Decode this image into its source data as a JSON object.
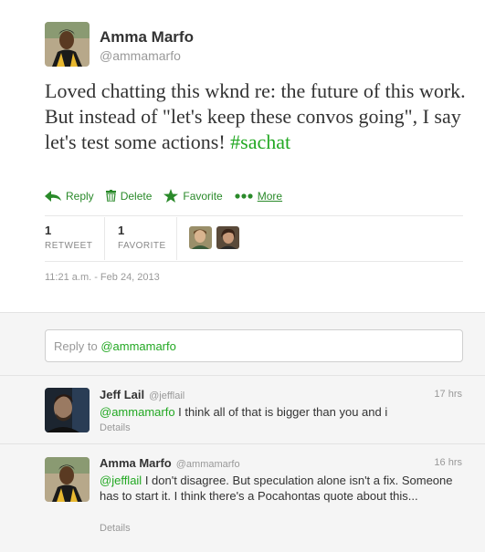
{
  "tweet": {
    "author_name": "Amma Marfo",
    "author_handle": "@ammamarfo",
    "text": "Loved chatting this wknd re: the future of this work. But instead of \"let's keep these convos going\", I say let's test some actions!",
    "hashtag": "#sachat",
    "timestamp": "11:21 a.m. - Feb 24, 2013"
  },
  "actions": {
    "reply": "Reply",
    "delete": "Delete",
    "favorite": "Favorite",
    "more": "More"
  },
  "stats": {
    "retweets_count": "1",
    "retweets_label": "RETWEET",
    "favorites_count": "1",
    "favorites_label": "FAVORITE"
  },
  "reply_box": {
    "prefix": "Reply to ",
    "mention": "@ammamarfo"
  },
  "replies": [
    {
      "name": "Jeff Lail",
      "handle": "@jefflail",
      "time": "17 hrs",
      "mention": "@ammamarfo",
      "text": " I think all of that is bigger than you and i",
      "details": "Details"
    },
    {
      "name": "Amma Marfo",
      "handle": "@ammamarfo",
      "time": "16 hrs",
      "mention": "@jefflail",
      "text": " I don't disagree. But speculation alone isn't a fix. Someone has to start it. I think there's a Pocahontas quote about this...",
      "details": "Details"
    }
  ],
  "colors": {
    "accent_green": "#22a822",
    "action_green": "#2a8a2a"
  }
}
